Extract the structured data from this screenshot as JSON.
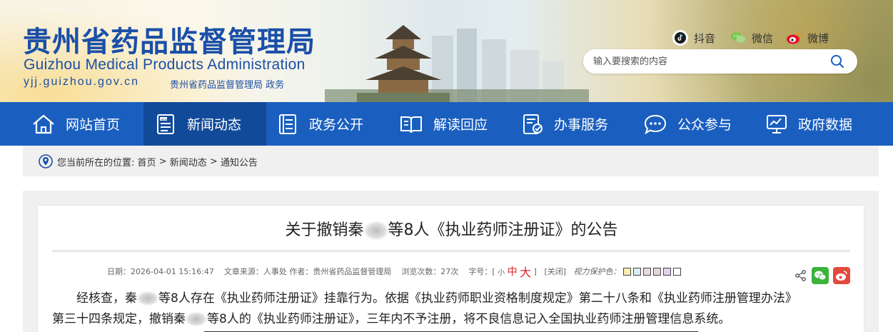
{
  "header": {
    "title_cn": "贵州省药品监督管理局",
    "title_en": "Guizhou Medical Products Administration",
    "domain": "yjj.guizhou.gov.cn",
    "domain_tag": "贵州省药品监督管理局 政务",
    "social": [
      {
        "icon": "douyin-icon",
        "label": "抖音"
      },
      {
        "icon": "wechat-icon",
        "label": "微信"
      },
      {
        "icon": "weibo-icon",
        "label": "微博"
      }
    ],
    "search": {
      "placeholder": "输入要搜索的内容"
    }
  },
  "nav": {
    "items": [
      {
        "icon": "home-icon",
        "label": "网站首页",
        "active": false
      },
      {
        "icon": "news-icon",
        "label": "新闻动态",
        "active": true
      },
      {
        "icon": "document-icon",
        "label": "政务公开",
        "active": false
      },
      {
        "icon": "book-icon",
        "label": "解读回应",
        "active": false
      },
      {
        "icon": "service-icon",
        "label": "办事服务",
        "active": false
      },
      {
        "icon": "chat-icon",
        "label": "公众参与",
        "active": false
      },
      {
        "icon": "data-icon",
        "label": "政府数据",
        "active": false
      }
    ]
  },
  "breadcrumb": {
    "prefix": "您当前所在的位置: ",
    "items": [
      "首页",
      "新闻动态",
      "通知公告"
    ],
    "separator": " > "
  },
  "article": {
    "title_part1": "关于撤销秦",
    "title_part2": "等8人《执业药师注册证》的公告",
    "meta": {
      "date": "日期：2026-04-01 15:16:47",
      "source": "文章来源：人事处",
      "author": "作者：贵州省药品监督管理局",
      "views": "浏览次数：27次",
      "font_label": "字号：[",
      "font_small": "小",
      "font_medium": "中",
      "font_large": "大",
      "font_close_bracket": "]",
      "close": "[关闭]",
      "eye_label": "视力保护色：",
      "eye_colors": [
        "#f8efb0",
        "#d9ecf5",
        "#ead8e6",
        "#e5d7d7",
        "#e2d3f2",
        "#ffffff"
      ]
    },
    "para1_part1": "经核查，秦",
    "para1_part2": "等8人存在《执业药师注册证》挂靠行为。依据《执业药师职业资格制度规定》第二十八条和《执业药师注册管理办法》",
    "para2_part1": "第三十四条规定，撤销秦",
    "para2_part2": "等8人的《执业药师注册证》，三年内不予注册，将不良信息记入全国执业药师注册管理信息系统。"
  }
}
